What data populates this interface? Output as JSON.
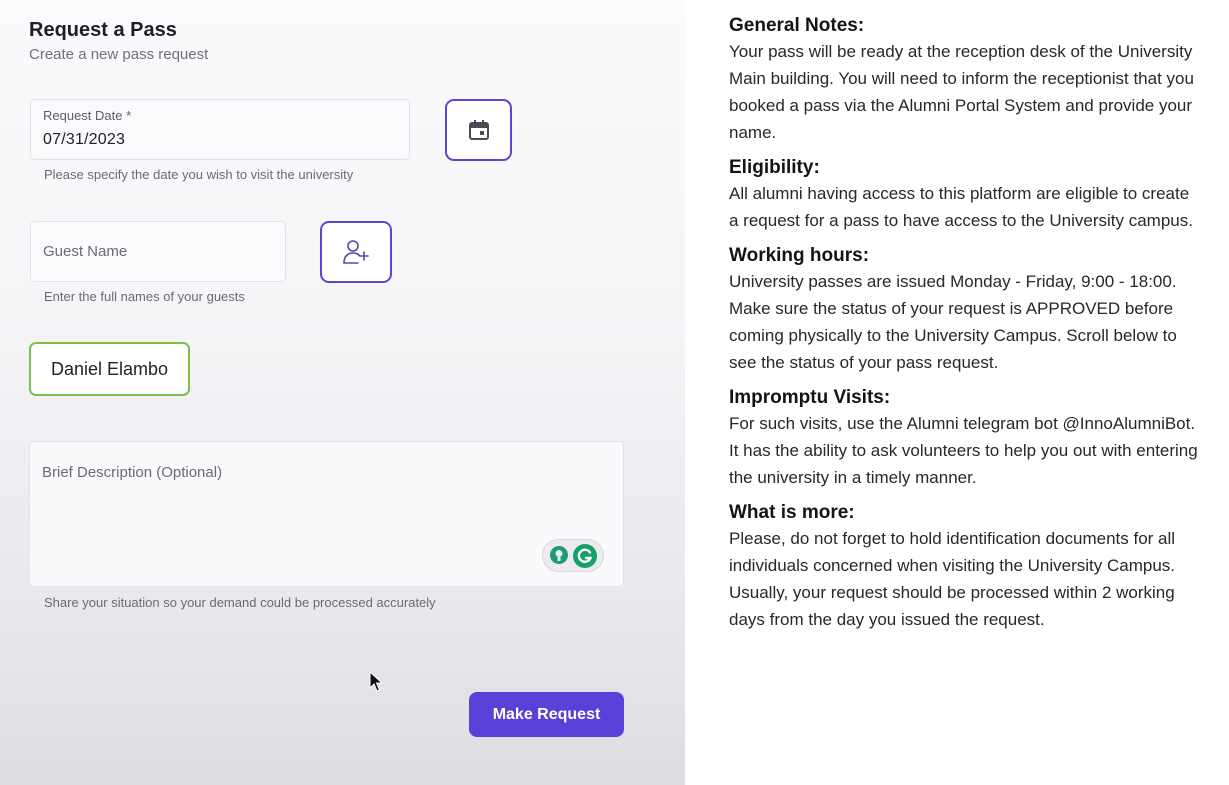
{
  "form": {
    "title": "Request a Pass",
    "subtitle": "Create a new pass request",
    "date_label": "Request Date *",
    "date_value": "07/31/2023",
    "date_helper": "Please specify the date you wish to visit the university",
    "guest_placeholder": "Guest Name",
    "guest_helper": "Enter the full names of your guests",
    "guest_chips": [
      "Daniel Elambo"
    ],
    "description_placeholder": "Brief Description (Optional)",
    "description_helper": "Share your situation so your demand could be processed accurately",
    "submit_label": "Make Request"
  },
  "notes": [
    {
      "heading": "General Notes:",
      "body": "Your pass will be ready at the reception desk of the University Main building. You will need to inform the receptionist that you booked a pass via the Alumni Portal System and provide your name."
    },
    {
      "heading": "Eligibility:",
      "body": "All alumni having access to this platform are eligible to create a request for a pass to have access to the University campus."
    },
    {
      "heading": "Working hours:",
      "body": "University passes are issued Monday - Friday, 9:00 - 18:00. Make sure the status of your request is APPROVED before coming physically to the University Campus. Scroll below to see the status of your pass request."
    },
    {
      "heading": "Impromptu Visits:",
      "body": "For such visits, use the Alumni telegram bot @InnoAlumniBot. It has the ability to ask volunteers to help you out with entering the university in a timely manner."
    },
    {
      "heading": "What is more:",
      "body": "Please, do not forget to hold identification documents for all individuals concerned when visiting the University Campus. Usually, your request should be processed within 2 working days from the day you issued the request."
    }
  ],
  "colors": {
    "accent": "#5b3fd9",
    "chip_border": "#7cc04a",
    "grammarly": "#15a06a"
  },
  "icons": {
    "calendar": "calendar-icon",
    "add_user": "add-user-icon",
    "grammarly": "grammarly-icon",
    "cursor": "mouse-cursor-icon"
  }
}
